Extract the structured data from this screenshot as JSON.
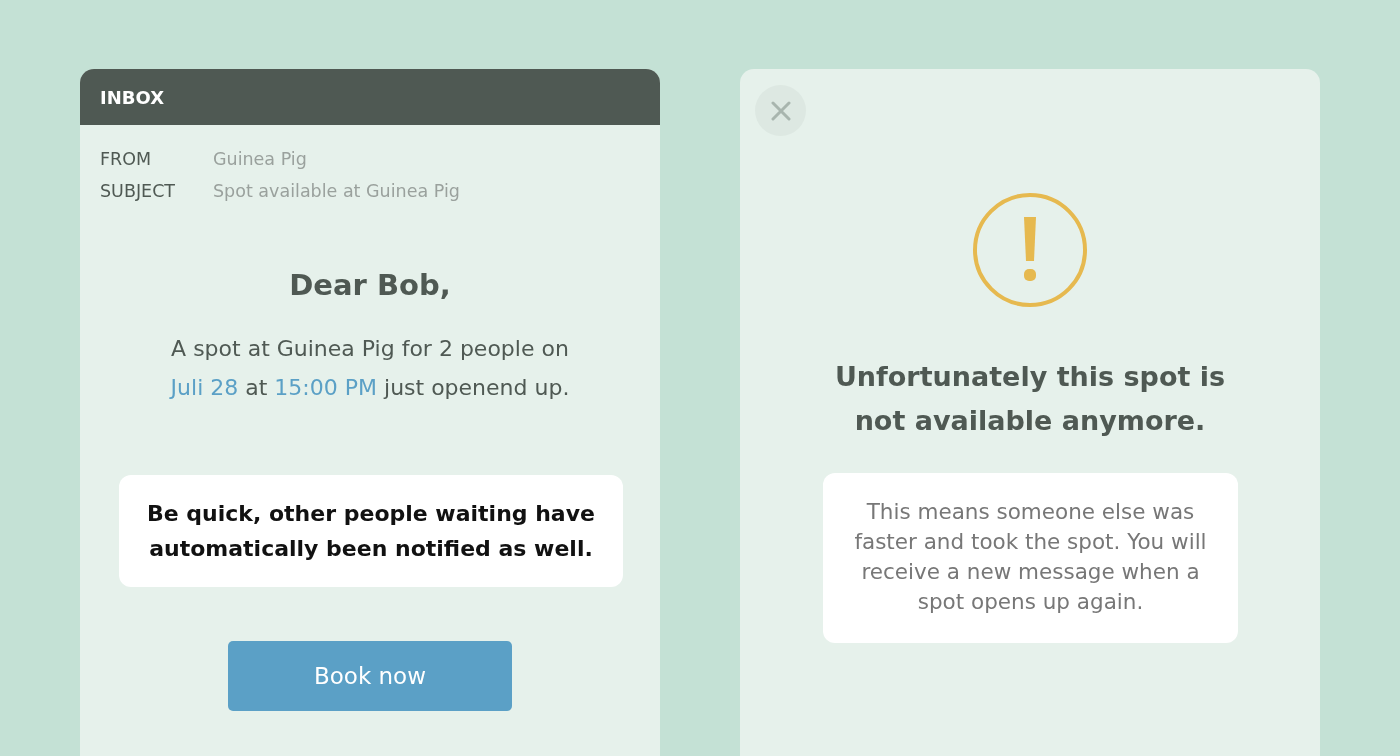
{
  "inbox": {
    "title": "INBOX",
    "fields": [
      {
        "label": "FROM",
        "value": "Guinea Pig"
      },
      {
        "label": "SUBJECT",
        "value": "Spot available at Guinea Pig"
      }
    ],
    "greeting": "Dear Bob,",
    "message": [
      {
        "text": "A spot at Guinea Pig for 2 people on",
        "highlight": false
      },
      {
        "text": "Juli 28",
        "highlight": true
      },
      {
        "text": "at",
        "highlight": false
      },
      {
        "text": "15:00 PM",
        "highlight": true
      },
      {
        "text": "just openend up.",
        "highlight": false
      }
    ],
    "notice": "Be quick, other people waiting have automatically been notified as well.",
    "button": "Book now"
  },
  "alert": {
    "heading": "Unfortunately this spot is not available anymore.",
    "explanation": "This means someone else was faster and took the spot. You will receive a new message when a spot opens up again."
  }
}
